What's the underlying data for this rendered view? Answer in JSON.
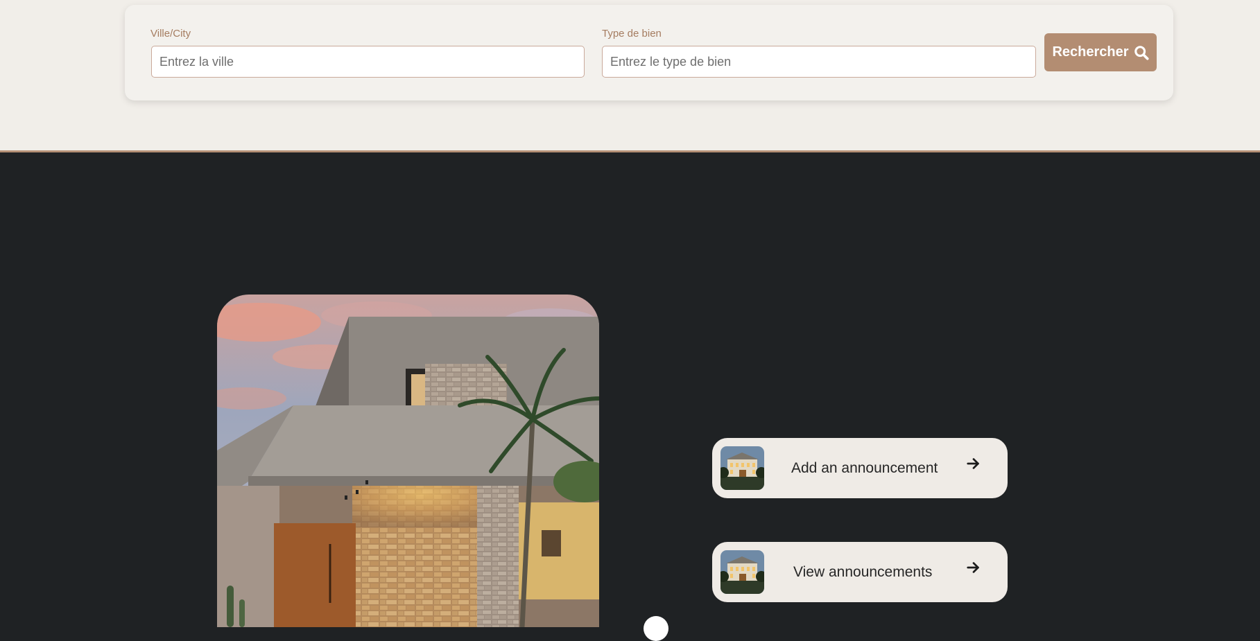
{
  "search": {
    "city_label": "Ville/City",
    "city_placeholder": "Entrez la ville",
    "city_value": "",
    "type_label": "Type de bien",
    "type_placeholder": "Entrez le type de bien",
    "type_value": "",
    "button_label": "Rechercher",
    "button_icon": "search-icon"
  },
  "actions": [
    {
      "label": "Add an announcement",
      "thumb_icon": "house-thumbnail",
      "arrow_icon": "arrow-right-icon"
    },
    {
      "label": "View announcements",
      "thumb_icon": "house-thumbnail",
      "arrow_icon": "arrow-right-icon"
    }
  ],
  "colors": {
    "accent": "#b38d72",
    "label": "#a57c60",
    "light_bg": "#f1eee9",
    "dark_bg": "#1f2224",
    "card_bg": "#efebe6"
  }
}
